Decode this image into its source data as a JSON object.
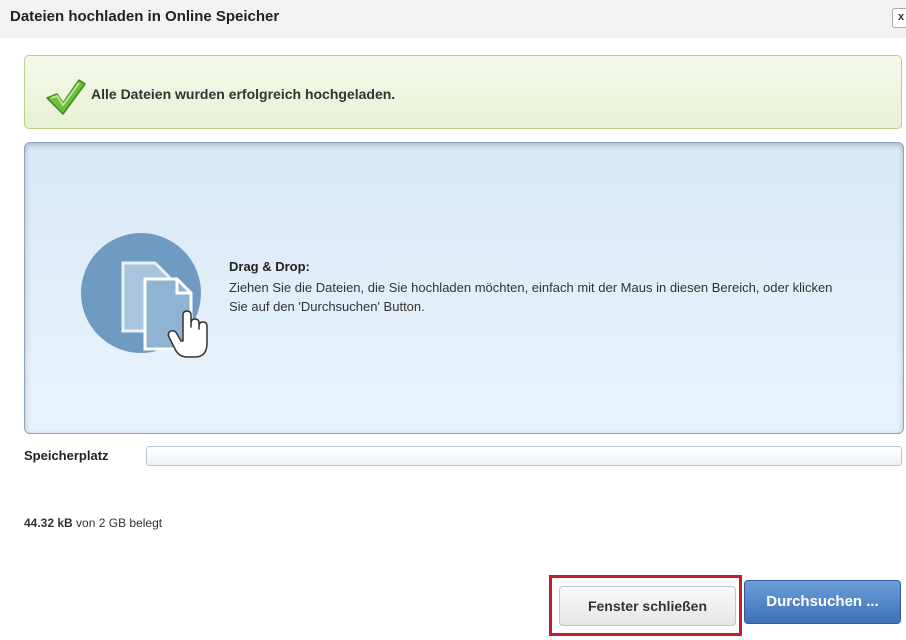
{
  "dialog": {
    "title": "Dateien hochladen in Online Speicher",
    "close_label": "x"
  },
  "success": {
    "message": "Alle Dateien wurden erfolgreich hochgeladen.",
    "icon": "checkmark-icon"
  },
  "dropzone": {
    "title": "Drag & Drop:",
    "text": "Ziehen Sie die Dateien, die Sie hochladen möchten, einfach mit der Maus in diesen Bereich, oder klicken Sie auf den 'Durchsuchen' Button.",
    "icon": "drag-drop-files-icon"
  },
  "storage": {
    "label": "Speicherplatz",
    "used_value": "44.32 kB",
    "used_suffix": "von 2 GB belegt",
    "fill_fraction": 0
  },
  "buttons": {
    "close_window": "Fenster schließen",
    "browse": "Durchsuchen ..."
  },
  "colors": {
    "success_border": "#b7d38a",
    "dropzone_bg": "#dae9f6",
    "primary_button": "#4a7fc1",
    "highlight": "#c0202b"
  }
}
